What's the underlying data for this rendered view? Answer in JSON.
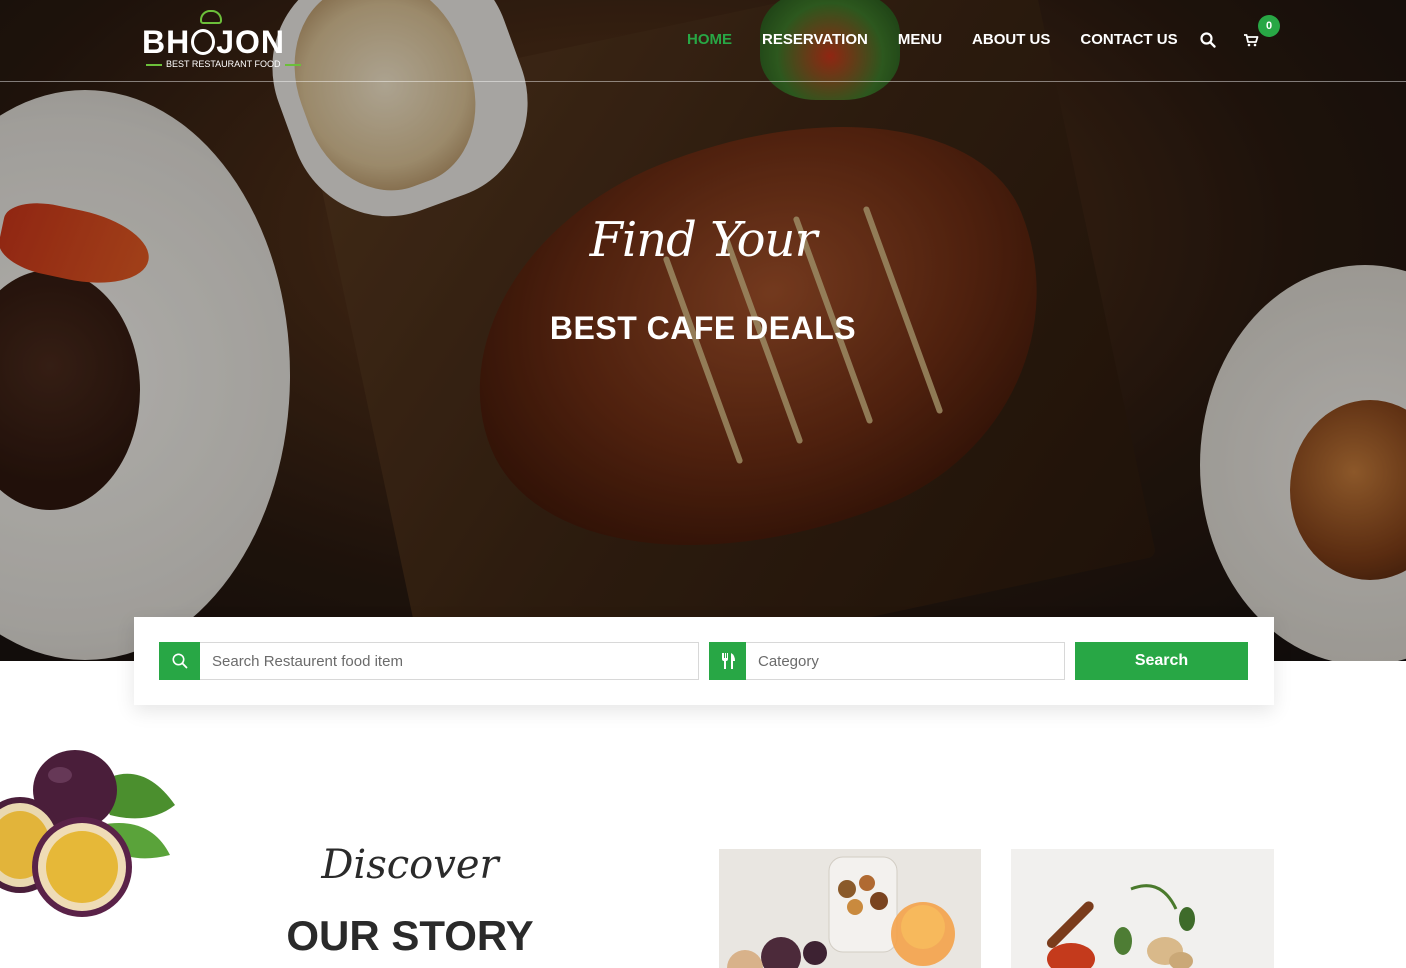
{
  "brand": {
    "name_left": "BH",
    "name_right": "JON",
    "tagline": "BEST RESTAURANT FOOD"
  },
  "nav": {
    "items": [
      {
        "label": "HOME",
        "active": true
      },
      {
        "label": "RESERVATION",
        "active": false
      },
      {
        "label": "MENU",
        "active": false
      },
      {
        "label": "ABOUT US",
        "active": false
      },
      {
        "label": "CONTACT US",
        "active": false
      }
    ],
    "cart_count": "0",
    "icons": {
      "search": "search-icon",
      "cart": "cart-icon"
    }
  },
  "hero": {
    "script": "Find Your",
    "title": "BEST CAFE DEALS"
  },
  "search": {
    "food_placeholder": "Search Restaurent food item",
    "category_placeholder": "Category",
    "button_label": "Search",
    "icons": {
      "food": "search-icon",
      "category": "utensils-icon"
    }
  },
  "story": {
    "script": "Discover",
    "title": "OUR STORY"
  },
  "colors": {
    "accent": "#28a745",
    "text_dark": "#2a2a2a",
    "white": "#ffffff"
  }
}
